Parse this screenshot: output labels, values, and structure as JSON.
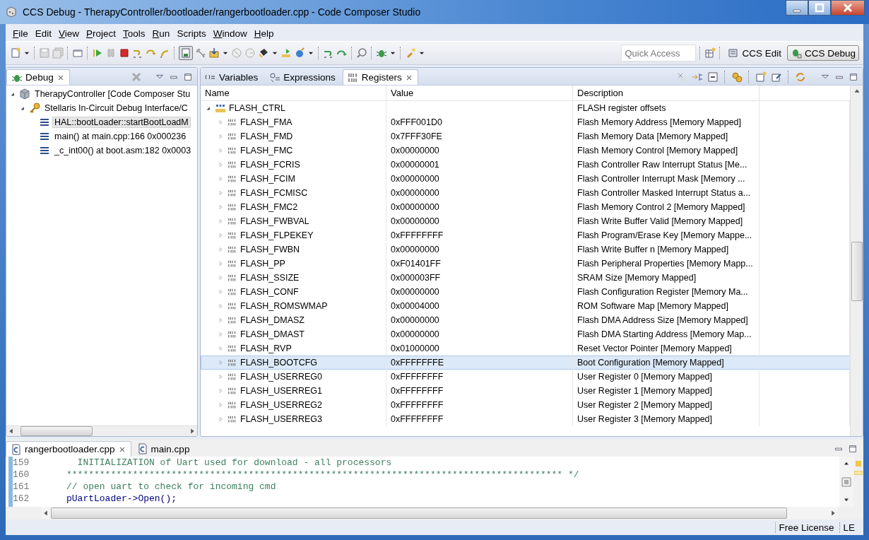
{
  "window": {
    "title": "CCS Debug - TherapyController/bootloader/rangerbootloader.cpp - Code Composer Studio"
  },
  "menu": [
    {
      "label": "File",
      "mnemonic": true
    },
    {
      "label": "Edit",
      "mnemonic": false
    },
    {
      "label": "View",
      "mnemonic": true
    },
    {
      "label": "Project",
      "mnemonic": true
    },
    {
      "label": "Tools",
      "mnemonic": true
    },
    {
      "label": "Run",
      "mnemonic": true
    },
    {
      "label": "Scripts",
      "mnemonic": false
    },
    {
      "label": "Window",
      "mnemonic": true
    },
    {
      "label": "Help",
      "mnemonic": true
    }
  ],
  "toolbar": {
    "quick_access": {
      "placeholder": "Quick Access"
    },
    "perspectives": [
      {
        "label": "CCS Edit",
        "selected": false
      },
      {
        "label": "CCS Debug",
        "selected": true
      }
    ]
  },
  "debug_view": {
    "tab": {
      "label": "Debug"
    },
    "tree": [
      {
        "label": "TherapyController [Code Composer Stu",
        "kind": "launch",
        "expanded": true,
        "children": [
          {
            "label": "Stellaris In-Circuit Debug Interface/C",
            "kind": "target",
            "expanded": true,
            "children": [
              {
                "label": "HAL::bootLoader::startBootLoadM",
                "kind": "frame",
                "selected": true
              },
              {
                "label": "main() at main.cpp:166 0x000236",
                "kind": "frame",
                "selected": false
              },
              {
                "label": "_c_int00() at boot.asm:182 0x0003",
                "kind": "frame",
                "selected": false
              }
            ]
          }
        ]
      }
    ]
  },
  "registers_view": {
    "tabs": [
      {
        "label": "Variables",
        "kind": "variables",
        "selected": false
      },
      {
        "label": "Expressions",
        "kind": "expressions",
        "selected": false
      },
      {
        "label": "Registers",
        "kind": "registers",
        "selected": true
      }
    ],
    "columns": [
      "Name",
      "Value",
      "Description"
    ],
    "rows": [
      {
        "name": "FLASH_CTRL",
        "kind": "group",
        "expanded": true,
        "description": "FLASH register offsets",
        "children": [
          {
            "name": "FLASH_FMA",
            "value": "0xFFF001D0",
            "description": "Flash Memory Address [Memory Mapped]",
            "expanded": false,
            "selected": false
          },
          {
            "name": "FLASH_FMD",
            "value": "0x7FFF30FE",
            "description": "Flash Memory Data [Memory Mapped]",
            "expanded": false,
            "selected": false
          },
          {
            "name": "FLASH_FMC",
            "value": "0x00000000",
            "description": "Flash Memory Control [Memory Mapped]",
            "expanded": false,
            "selected": false
          },
          {
            "name": "FLASH_FCRIS",
            "value": "0x00000001",
            "description": "Flash Controller Raw Interrupt Status [Me...",
            "expanded": false,
            "selected": false
          },
          {
            "name": "FLASH_FCIM",
            "value": "0x00000000",
            "description": "Flash Controller Interrupt Mask [Memory ...",
            "expanded": false,
            "selected": false
          },
          {
            "name": "FLASH_FCMISC",
            "value": "0x00000000",
            "description": "Flash Controller Masked Interrupt Status a...",
            "expanded": false,
            "selected": false
          },
          {
            "name": "FLASH_FMC2",
            "value": "0x00000000",
            "description": "Flash Memory Control 2 [Memory Mapped]",
            "expanded": false,
            "selected": false
          },
          {
            "name": "FLASH_FWBVAL",
            "value": "0x00000000",
            "description": "Flash Write Buffer Valid [Memory Mapped]",
            "expanded": false,
            "selected": false
          },
          {
            "name": "FLASH_FLPEKEY",
            "value": "0xFFFFFFFF",
            "description": "Flash Program/Erase Key [Memory Mappe...",
            "expanded": false,
            "selected": false
          },
          {
            "name": "FLASH_FWBN",
            "value": "0x00000000",
            "description": "Flash Write Buffer n [Memory Mapped]",
            "expanded": false,
            "selected": false
          },
          {
            "name": "FLASH_PP",
            "value": "0xF01401FF",
            "description": "Flash Peripheral Properties [Memory Mapp...",
            "expanded": false,
            "selected": false
          },
          {
            "name": "FLASH_SSIZE",
            "value": "0x000003FF",
            "description": "SRAM Size [Memory Mapped]",
            "expanded": false,
            "selected": false
          },
          {
            "name": "FLASH_CONF",
            "value": "0x00000000",
            "description": "Flash Configuration Register [Memory Ma...",
            "expanded": false,
            "selected": false
          },
          {
            "name": "FLASH_ROMSWMAP",
            "value": "0x00004000",
            "description": "ROM Software Map [Memory Mapped]",
            "expanded": false,
            "selected": false
          },
          {
            "name": "FLASH_DMASZ",
            "value": "0x00000000",
            "description": "Flash DMA Address Size [Memory Mapped]",
            "expanded": false,
            "selected": false
          },
          {
            "name": "FLASH_DMAST",
            "value": "0x00000000",
            "description": "Flash DMA Starting Address [Memory Map...",
            "expanded": false,
            "selected": false
          },
          {
            "name": "FLASH_RVP",
            "value": "0x01000000",
            "description": "Reset Vector Pointer [Memory Mapped]",
            "expanded": false,
            "selected": false
          },
          {
            "name": "FLASH_BOOTCFG",
            "value": "0xFFFFFFFE",
            "description": "Boot Configuration [Memory Mapped]",
            "expanded": false,
            "selected": true
          },
          {
            "name": "FLASH_USERREG0",
            "value": "0xFFFFFFFF",
            "description": "User Register 0 [Memory Mapped]",
            "expanded": false,
            "selected": false
          },
          {
            "name": "FLASH_USERREG1",
            "value": "0xFFFFFFFF",
            "description": "User Register 1 [Memory Mapped]",
            "expanded": false,
            "selected": false
          },
          {
            "name": "FLASH_USERREG2",
            "value": "0xFFFFFFFF",
            "description": "User Register 2 [Memory Mapped]",
            "expanded": false,
            "selected": false
          },
          {
            "name": "FLASH_USERREG3",
            "value": "0xFFFFFFFF",
            "description": "User Register 3 [Memory Mapped]",
            "expanded": false,
            "selected": false
          }
        ]
      }
    ]
  },
  "editor": {
    "tabs": [
      {
        "label": "rangerbootloader.cpp",
        "selected": true
      },
      {
        "label": "main.cpp",
        "selected": false
      }
    ],
    "lines": [
      {
        "number": "159",
        "kind": "comment",
        "text": "  INITIALIZATION of Uart used for download - all processors"
      },
      {
        "number": "160",
        "kind": "comment",
        "text": "****************************************************************************************** */"
      },
      {
        "number": "161",
        "kind": "comment",
        "text": "// open uart to check for incoming cmd"
      },
      {
        "number": "162",
        "kind": "code",
        "text": "pUartLoader->Open();"
      }
    ]
  },
  "status_bar": {
    "items": [
      "Free License",
      "LE"
    ]
  }
}
